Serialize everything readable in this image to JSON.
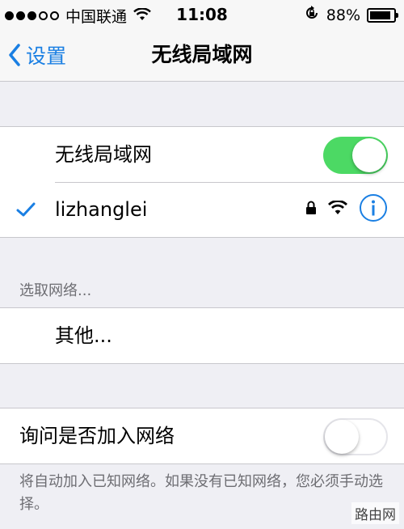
{
  "status_bar": {
    "carrier": "中国联通",
    "time": "11:08",
    "battery_percent": "88%",
    "battery_level": 0.88,
    "signal_filled": 3,
    "signal_total": 5
  },
  "nav": {
    "back_label": "设置",
    "title": "无线局域网"
  },
  "wifi_group": {
    "toggle_label": "无线局域网",
    "toggle_on": true,
    "connected_network": "lizhanglei",
    "connected_icons": [
      "checkmark-icon",
      "lock-icon",
      "wifi-icon",
      "info-icon"
    ]
  },
  "choose_network": {
    "header": "选取网络...",
    "other_label": "其他..."
  },
  "ask_join": {
    "label": "询问是否加入网络",
    "toggle_on": false,
    "footer": "将自动加入已知网络。如果没有已知网络，您必须手动选择。"
  },
  "watermark": "路由网",
  "colors": {
    "accent": "#1a7fe3",
    "toggle_on": "#4cd964",
    "background": "#efeff4"
  }
}
